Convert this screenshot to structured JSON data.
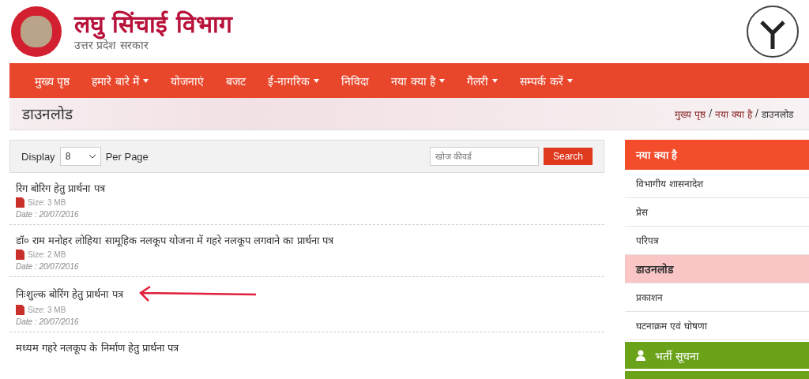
{
  "header": {
    "title": "लघु सिंचाई विभाग",
    "subtitle": "उत्तर प्रदेश सरकार"
  },
  "nav": [
    {
      "label": "मुख्य पृष्ठ",
      "dropdown": false
    },
    {
      "label": "हमारे बारे में",
      "dropdown": true
    },
    {
      "label": "योजनाएं",
      "dropdown": false
    },
    {
      "label": "बजट",
      "dropdown": false
    },
    {
      "label": "ई-नागरिक",
      "dropdown": true
    },
    {
      "label": "निविदा",
      "dropdown": false
    },
    {
      "label": "नया क्या है",
      "dropdown": true
    },
    {
      "label": "गैलरी",
      "dropdown": true
    },
    {
      "label": "सम्पर्क करें",
      "dropdown": true
    }
  ],
  "page_title": "डाउनलोड",
  "breadcrumb": {
    "separator": "/",
    "items": [
      "मुख्य पृष्ठ",
      "नया क्या है",
      "डाउनलोड"
    ]
  },
  "toolbar": {
    "display_label": "Display",
    "per_page": "8",
    "per_page_label": "Per Page",
    "search_placeholder": "खोज कीवर्ड",
    "search_button": "Search"
  },
  "documents": [
    {
      "title": "रिग बोरिग हेतु प्रार्थना पत्र",
      "size": "Size: 3 MB",
      "date": "Date : 20/07/2016",
      "arrow": false
    },
    {
      "title": "डॉ० राम मनोहर लोहिया सामूहिक नलकूप योजना में गहरे नलकूप लगवाने का प्रार्थना पत्र",
      "size": "Size: 2 MB",
      "date": "Date : 20/07/2016",
      "arrow": false
    },
    {
      "title": "निःशुल्क बोरिंग हेतु प्रार्थना पत्र",
      "size": "Size: 3 MB",
      "date": "Date : 20/07/2016",
      "arrow": true
    },
    {
      "title": "मध्यम गहरे नलकूप के निर्माण हेतु प्रार्थना पत्र",
      "arrow": false
    }
  ],
  "sidebar": {
    "heading": "नया क्या है",
    "items": [
      {
        "label": "विभागीय शासनादेश",
        "selected": false
      },
      {
        "label": "प्रेस",
        "selected": false
      },
      {
        "label": "परिपत्र",
        "selected": false
      },
      {
        "label": "डाउनलोड",
        "selected": true
      },
      {
        "label": "प्रकाशन",
        "selected": false
      },
      {
        "label": "घटनाक्रम एवं घोषणा",
        "selected": false
      }
    ],
    "sections": [
      {
        "label": "भर्ती सूचना"
      }
    ]
  }
}
